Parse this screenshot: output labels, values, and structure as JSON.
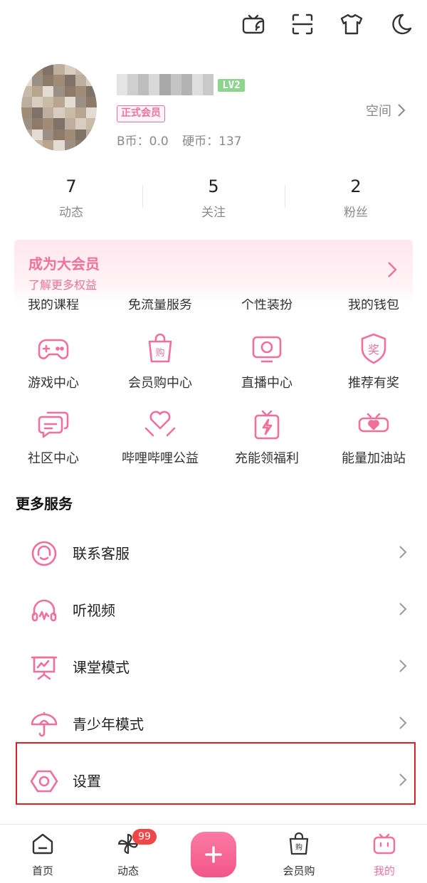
{
  "colors": {
    "accent": "#f0709a",
    "highlight": "#e02020",
    "badge": "#f04646",
    "level": "#8fd48f"
  },
  "top_icons": [
    "tv-cast-icon",
    "scan-icon",
    "tshirt-icon",
    "moon-icon"
  ],
  "profile": {
    "level": "LV2",
    "vip_tag": "正式会员",
    "bcoin": "B币：0.0",
    "coin": "硬币：137",
    "space_label": "空间"
  },
  "stats": [
    {
      "num": "7",
      "label": "动态"
    },
    {
      "num": "5",
      "label": "关注"
    },
    {
      "num": "2",
      "label": "粉丝"
    }
  ],
  "vip_banner": {
    "title": "成为大会员",
    "subtitle": "了解更多权益"
  },
  "grid_cut": [
    "我的课程",
    "免流量服务",
    "个性装扮",
    "我的钱包"
  ],
  "grid_row1": [
    {
      "label": "游戏中心",
      "icon": "gamepad-icon"
    },
    {
      "label": "会员购中心",
      "icon": "shopping-bag-icon"
    },
    {
      "label": "直播中心",
      "icon": "live-tv-icon"
    },
    {
      "label": "推荐有奖",
      "icon": "reward-shield-icon"
    }
  ],
  "grid_row2": [
    {
      "label": "社区中心",
      "icon": "chat-bubbles-icon"
    },
    {
      "label": "哔哩哔哩公益",
      "icon": "heart-hands-icon"
    },
    {
      "label": "充能领福利",
      "icon": "gift-bolt-icon"
    },
    {
      "label": "能量加油站",
      "icon": "energy-heart-icon"
    }
  ],
  "more_services": {
    "title": "更多服务",
    "items": [
      {
        "label": "联系客服",
        "icon": "headset-icon"
      },
      {
        "label": "听视频",
        "icon": "headphones-icon"
      },
      {
        "label": "课堂模式",
        "icon": "classroom-board-icon"
      },
      {
        "label": "青少年模式",
        "icon": "umbrella-icon"
      },
      {
        "label": "设置",
        "icon": "settings-hexagon-icon"
      }
    ]
  },
  "bottom_nav": [
    {
      "label": "首页",
      "icon": "home-icon"
    },
    {
      "label": "动态",
      "icon": "pinwheel-icon",
      "badge": "99"
    },
    {
      "label": "",
      "icon": "plus-icon"
    },
    {
      "label": "会员购",
      "icon": "shopping-bag-icon"
    },
    {
      "label": "我的",
      "icon": "tv-mine-icon"
    }
  ]
}
